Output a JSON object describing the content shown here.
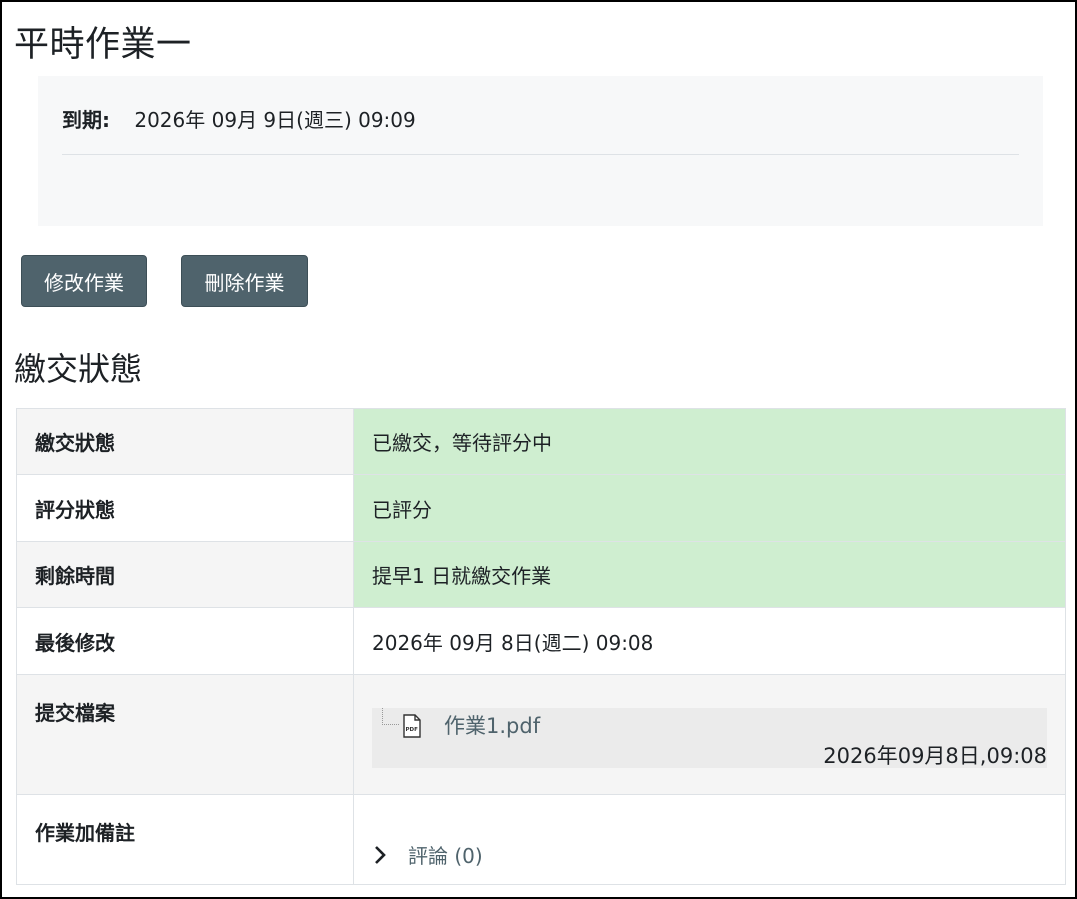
{
  "title": "平時作業一",
  "due": {
    "label": "到期:",
    "value": "2026年 09月 9日(週三) 09:09"
  },
  "buttons": {
    "edit": "修改作業",
    "delete": "刪除作業"
  },
  "section_title": "繳交狀態",
  "rows": {
    "submission_status": {
      "label": "繳交狀態",
      "value": "已繳交，等待評分中"
    },
    "grading_status": {
      "label": "評分狀態",
      "value": "已評分"
    },
    "time_remaining": {
      "label": "剩餘時間",
      "value": "提早1 日就繳交作業"
    },
    "last_modified": {
      "label": "最後修改",
      "value": "2026年 09月 8日(週二) 09:08"
    },
    "file_submissions": {
      "label": "提交檔案",
      "file_name": "作業1.pdf",
      "file_date": "2026年09月8日,09:08"
    },
    "submission_comments": {
      "label": "作業加備註",
      "comments_link": "評論 (0)"
    }
  },
  "colors": {
    "button_bg": "#4f636c",
    "success_bg": "#cfeed0",
    "link": "#4f636c"
  },
  "icons": {
    "file": "pdf-file-icon",
    "expand": "chevron-right-icon"
  }
}
